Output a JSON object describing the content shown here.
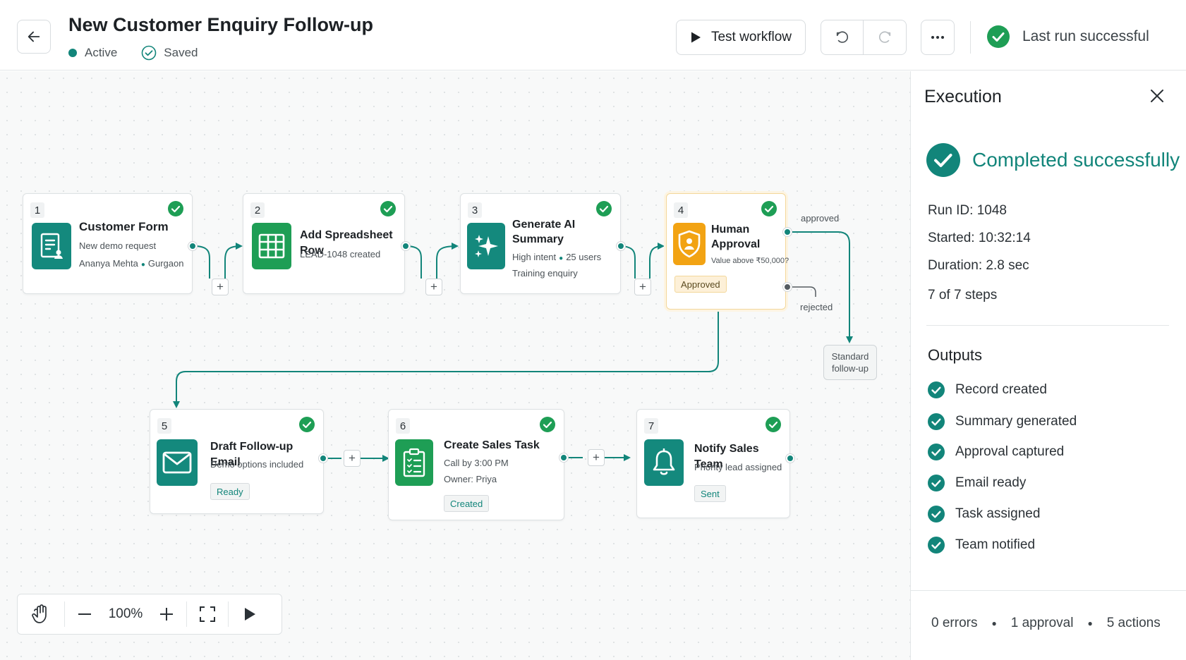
{
  "header": {
    "title": "New Customer Enquiry Follow-up",
    "status_active": "Active",
    "status_saved": "Saved",
    "test_workflow": "Test workflow",
    "last_run": "Last run successful"
  },
  "nodes": [
    {
      "num": "1",
      "title": "Customer Form",
      "sub1": "New demo request",
      "sub2a": "Ananya Mehta",
      "sub2b": "Gurgaon",
      "icon": "form-icon"
    },
    {
      "num": "2",
      "title": "Add Spreadsheet Row",
      "sub1": "LEAD-1048 created",
      "icon": "spreadsheet-icon"
    },
    {
      "num": "3",
      "title_l1": "Generate AI",
      "title_l2": "Summary",
      "sub1a": "High intent",
      "sub1b": "25 users",
      "sub2": "Training enquiry",
      "icon": "sparkles-icon"
    },
    {
      "num": "4",
      "title_l1": "Human",
      "title_l2": "Approval",
      "sub1": "Value above ₹50,000?",
      "chip": "Approved",
      "icon": "shield-user-icon"
    },
    {
      "num": "5",
      "title": "Draft Follow-up Email",
      "sub1": "Demo options included",
      "chip": "Ready",
      "icon": "mail-icon"
    },
    {
      "num": "6",
      "title": "Create Sales Task",
      "sub1": "Call by 3:00 PM",
      "sub2": "Owner: Priya",
      "chip": "Created",
      "icon": "clipboard-checklist-icon"
    },
    {
      "num": "7",
      "title": "Notify Sales Team",
      "sub1": "Priority lead assigned",
      "chip": "Sent",
      "icon": "bell-icon"
    }
  ],
  "branches": {
    "approved": "approved",
    "rejected": "rejected",
    "standard_followup": "Standard\nfollow-up"
  },
  "zoom": {
    "value": "100%"
  },
  "execution": {
    "title": "Execution",
    "status": "Completed successfully",
    "run_id": "Run ID:  1048",
    "started": "Started:  10:32:14",
    "duration": "Duration:  2.8 sec",
    "steps": "7 of 7 steps",
    "outputs_title": "Outputs",
    "outputs": [
      "Record created",
      "Summary generated",
      "Approval captured",
      "Email ready",
      "Task assigned",
      "Team notified"
    ],
    "summary": {
      "errors": "0 errors",
      "approvals": "1 approval",
      "actions": "5 actions"
    }
  },
  "colors": {
    "accent": "#12857a",
    "success": "#1e9e55",
    "warning": "#f2a313"
  }
}
